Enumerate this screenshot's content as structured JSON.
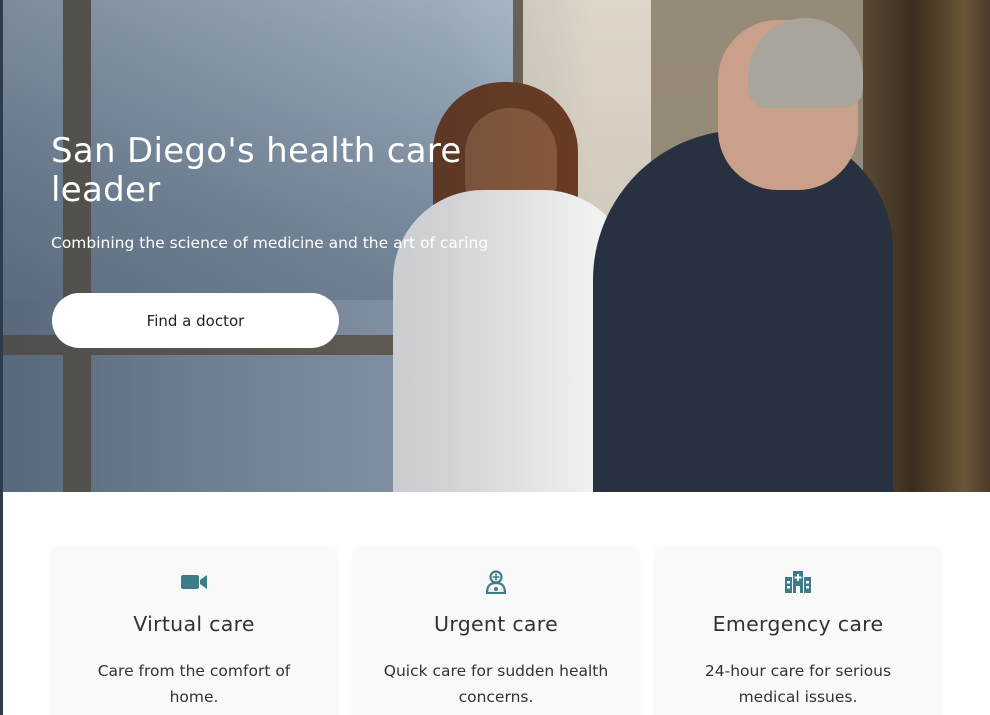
{
  "hero": {
    "title": "San Diego's health care leader",
    "subtitle": "Combining the science of medicine and the art of caring",
    "cta_label": "Find a doctor"
  },
  "cards": [
    {
      "icon": "video-camera-icon",
      "title": "Virtual care",
      "description": "Care from the comfort of home."
    },
    {
      "icon": "doctor-icon",
      "title": "Urgent care",
      "description": "Quick care for sudden health concerns."
    },
    {
      "icon": "hospital-icon",
      "title": "Emergency care",
      "description": "24-hour care for serious medical issues."
    }
  ],
  "colors": {
    "accent_icon": "#3e7d87",
    "text": "#333333",
    "card_bg": "#f9f9f9"
  }
}
